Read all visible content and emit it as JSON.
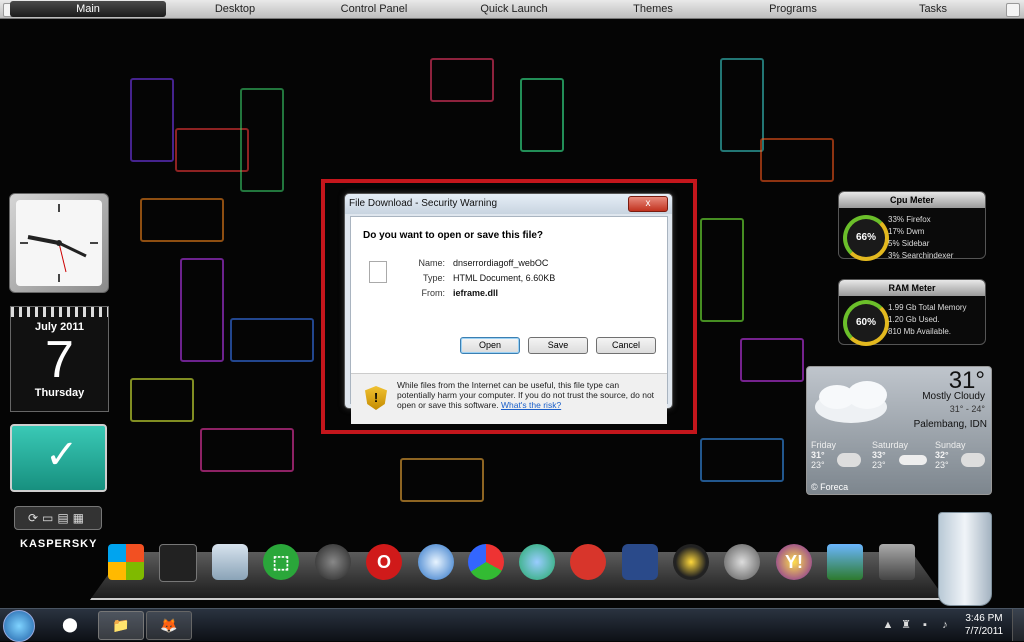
{
  "topbar": {
    "tabs": [
      "Main",
      "Desktop",
      "Control Panel",
      "Quick Launch",
      "Themes",
      "Programs",
      "Tasks"
    ]
  },
  "calendar": {
    "month": "July 2011",
    "day": "7",
    "weekday": "Thursday"
  },
  "kaspersky": {
    "brand": "KASPERSKY"
  },
  "cpu_meter": {
    "title": "Cpu Meter",
    "value": "66%",
    "lines": [
      "33% Firefox",
      "17% Dwm",
      "5% Sidebar",
      "3% Searchindexer"
    ]
  },
  "ram_meter": {
    "title": "RAM Meter",
    "value": "60%",
    "lines": [
      "1.99 Gb Total Memory",
      "1.20 Gb Used.",
      "810 Mb Available."
    ]
  },
  "weather": {
    "temp": "31°",
    "condition": "Mostly Cloudy",
    "range": "31° - 24°",
    "city": "Palembang, IDN",
    "forecast": [
      {
        "day": "Friday",
        "hi": "31°",
        "lo": "23°"
      },
      {
        "day": "Saturday",
        "hi": "33°",
        "lo": "23°"
      },
      {
        "day": "Sunday",
        "hi": "32°",
        "lo": "23°"
      }
    ],
    "footer": "© Foreca"
  },
  "dialog": {
    "title": "File Download - Security Warning",
    "close_label": "x",
    "question": "Do you want to open or save this file?",
    "name_label": "Name:",
    "name_value": "dnserrordiagoff_webOC",
    "type_label": "Type:",
    "type_value": "HTML Document, 6.60KB",
    "from_label": "From:",
    "from_value": "ieframe.dll",
    "open_label": "Open",
    "save_label": "Save",
    "cancel_label": "Cancel",
    "warning_text": "While files from the Internet can be useful, this file type can potentially harm your computer. If you do not trust the source, do not open or save this software.",
    "risk_link": "What's the risk?"
  },
  "taskbar": {
    "time": "3:46 PM",
    "date": "7/7/2011"
  },
  "colors": {
    "highlight": "#c4161c",
    "accent": "#1a5fc9"
  }
}
